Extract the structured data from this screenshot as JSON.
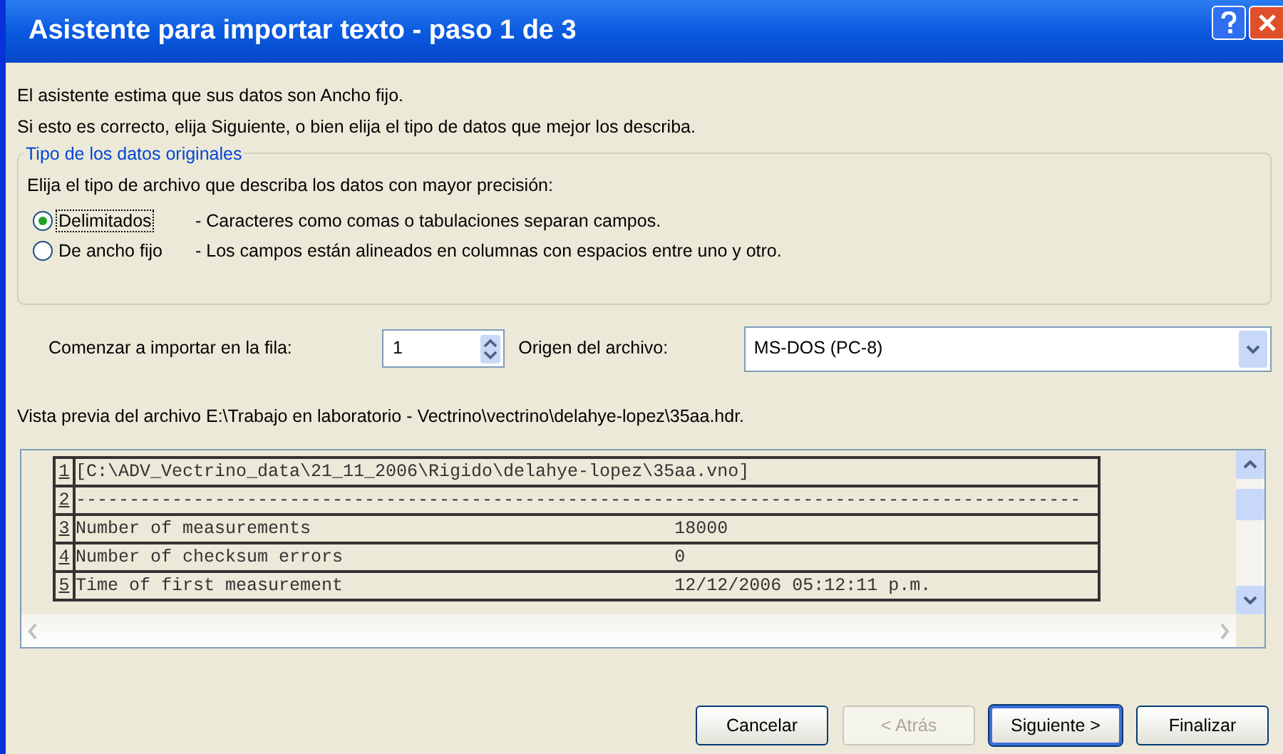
{
  "window": {
    "title": "Asistente para importar texto - paso 1 de 3"
  },
  "intro": [
    "El asistente estima que sus datos son Ancho fijo.",
    "Si esto es correcto, elija Siguiente, o bien elija el tipo de datos que mejor los describa."
  ],
  "group": {
    "title": "Tipo de los datos originales",
    "prompt": "Elija el tipo de archivo que describa los datos con mayor precisión:",
    "options": [
      {
        "label": "Delimitados",
        "description": "- Caracteres como comas o tabulaciones separan campos.",
        "selected": true,
        "focused": true
      },
      {
        "label": "De ancho fijo",
        "description": "- Los campos están alineados en columnas con espacios entre uno y otro.",
        "selected": false,
        "focused": false
      }
    ]
  },
  "start_row": {
    "label": "Comenzar a importar en la fila:",
    "value": "1"
  },
  "origin": {
    "label": "Origen del archivo:",
    "value": "MS-DOS (PC-8)"
  },
  "preview": {
    "label": "Vista previa del archivo E:\\Trabajo en laboratorio - Vectrino\\vectrino\\delahye-lopez\\35aa.hdr.",
    "lines": [
      {
        "number": "1",
        "text": "[C:\\ADV_Vectrino_data\\21_11_2006\\Rigido\\delahye-lopez\\35aa.vno]"
      },
      {
        "number": "2",
        "text": "----------------------------------------------------------------------------------------------"
      },
      {
        "number": "3",
        "text": "Number of measurements                                  18000"
      },
      {
        "number": "4",
        "text": "Number of checksum errors                               0"
      },
      {
        "number": "5",
        "text": "Time of first measurement                               12/12/2006 05:12:11 p.m."
      }
    ]
  },
  "buttons": [
    {
      "label": "Cancelar",
      "disabled": false,
      "default": false
    },
    {
      "label": "< Atrás",
      "disabled": true,
      "default": false
    },
    {
      "label": "Siguiente >",
      "disabled": false,
      "default": true
    },
    {
      "label": "Finalizar",
      "disabled": false,
      "default": false
    }
  ]
}
